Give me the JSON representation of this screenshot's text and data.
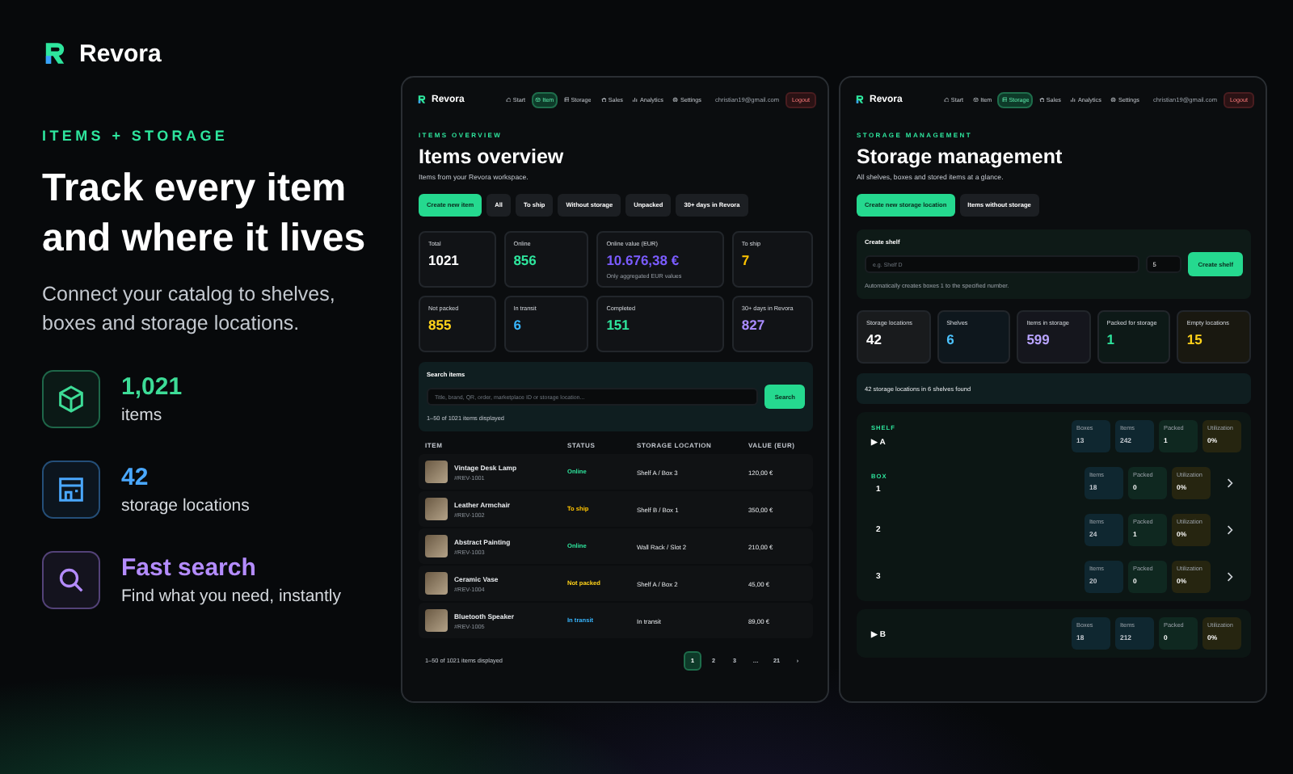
{
  "brand": {
    "name": "Revora"
  },
  "hero": {
    "eyebrow": "ITEMS + STORAGE",
    "headline": "Track every item and where it lives",
    "subtitle": "Connect your catalog to shelves, boxes and storage locations.",
    "features": [
      {
        "kind": "box",
        "color": "#3ddc97",
        "value": "1,021",
        "label": "items"
      },
      {
        "kind": "storage",
        "color": "#4aa8ff",
        "value": "42",
        "label": "storage locations"
      },
      {
        "kind": "search",
        "color": "#b48cff",
        "value": "Fast search",
        "label": "Find what you need, instantly"
      }
    ]
  },
  "items_app": {
    "nav": {
      "brand": "Revora",
      "tabs": [
        {
          "kind": "home",
          "label": "Start",
          "selected": false
        },
        {
          "kind": "item",
          "label": "Item",
          "selected": true
        },
        {
          "kind": "storage",
          "label": "Storage",
          "selected": false
        },
        {
          "kind": "sales",
          "label": "Sales",
          "selected": false
        },
        {
          "kind": "analytics",
          "label": "Analytics",
          "selected": false
        },
        {
          "kind": "settings",
          "label": "Settings",
          "selected": false
        }
      ],
      "account": "christian19@gmail.com",
      "logout": "Logout"
    },
    "eyebrow": "ITEMS OVERVIEW",
    "title": "Items overview",
    "subtitle": "Items from your Revora workspace.",
    "primary_action": "Create new item",
    "filters": [
      "All",
      "To ship",
      "Without storage",
      "Unpacked",
      "30+ days in Revora"
    ],
    "stats": [
      {
        "label": "Total",
        "value": "1021",
        "color": "#ffffff"
      },
      {
        "label": "Online",
        "value": "856",
        "color": "#2ee59d"
      },
      {
        "label": "Online value (EUR)",
        "value": "10.676,38 €",
        "color": "#7b5cff",
        "note": "Only aggregated EUR values"
      },
      {
        "label": "To ship",
        "value": "7",
        "color": "#ffc400"
      },
      {
        "label": "Not packed",
        "value": "855",
        "color": "#ffd21a"
      },
      {
        "label": "In transit",
        "value": "6",
        "color": "#38b6ff"
      },
      {
        "label": "Completed",
        "value": "151",
        "color": "#2ee59d"
      },
      {
        "label": "30+ days in Revora",
        "value": "827",
        "color": "#a98bff"
      }
    ],
    "search": {
      "title": "Search items",
      "placeholder": "Title, brand, QR, order, marketplace ID or storage location...",
      "button": "Search",
      "count": "1–50 of 1021 items displayed"
    },
    "table": {
      "columns": [
        "ITEM",
        "STATUS",
        "STORAGE LOCATION",
        "VALUE (EUR)"
      ],
      "rows": [
        {
          "name": "Vintage Desk Lamp",
          "sku": "#REV-1001",
          "status": "Online",
          "color": "#2ee59d",
          "location": "Shelf A / Box 3",
          "value": "120,00 €"
        },
        {
          "name": "Leather Armchair",
          "sku": "#REV-1002",
          "status": "To ship",
          "color": "#ffc400",
          "location": "Shelf B / Box 1",
          "value": "350,00 €"
        },
        {
          "name": "Abstract Painting",
          "sku": "#REV-1003",
          "status": "Online",
          "color": "#2ee59d",
          "location": "Wall Rack / Slot 2",
          "value": "210,00 €"
        },
        {
          "name": "Ceramic Vase",
          "sku": "#REV-1004",
          "status": "Not packed",
          "color": "#ffd21a",
          "location": "Shelf A / Box 2",
          "value": "45,00 €"
        },
        {
          "name": "Bluetooth Speaker",
          "sku": "#REV-1005",
          "status": "In transit",
          "color": "#38b6ff",
          "location": "In transit",
          "value": "89,00 €"
        }
      ]
    },
    "pagination": {
      "count": "1–50 of 1021 items displayed",
      "pages": [
        {
          "label": "1",
          "selected": true
        },
        {
          "label": "2",
          "selected": false
        },
        {
          "label": "3",
          "selected": false
        },
        {
          "label": "…",
          "selected": false
        },
        {
          "label": "21",
          "selected": false
        }
      ],
      "next": "›"
    }
  },
  "storage_app": {
    "nav": {
      "brand": "Revora",
      "tabs": [
        {
          "kind": "home",
          "label": "Start",
          "selected": false
        },
        {
          "kind": "item",
          "label": "Item",
          "selected": false
        },
        {
          "kind": "storage",
          "label": "Storage",
          "selected": true
        },
        {
          "kind": "sales",
          "label": "Sales",
          "selected": false
        },
        {
          "kind": "analytics",
          "label": "Analytics",
          "selected": false
        },
        {
          "kind": "settings",
          "label": "Settings",
          "selected": false
        }
      ],
      "account": "christian19@gmail.com",
      "logout": "Logout"
    },
    "eyebrow": "STORAGE MANAGEMENT",
    "title": "Storage management",
    "subtitle": "All shelves, boxes and stored items at a glance.",
    "actions": [
      {
        "kind": "primary",
        "label": "Create new storage location"
      },
      {
        "kind": "secondary",
        "label": "Items without storage"
      }
    ],
    "create_shelf": {
      "title": "Create shelf",
      "placeholder": "e.g. Shelf D",
      "box_count": "5",
      "button": "Create shelf",
      "hint": "Automatically creates boxes 1 to the specified number."
    },
    "stats": [
      {
        "label": "Storage locations",
        "value": "42",
        "color": "#ffffff"
      },
      {
        "label": "Shelves",
        "value": "6",
        "color": "#4cc3ff"
      },
      {
        "label": "Items in storage",
        "value": "599",
        "color": "#b9a4ff"
      },
      {
        "label": "Packed for storage",
        "value": "1",
        "color": "#2ee59d"
      },
      {
        "label": "Empty locations",
        "value": "15",
        "color": "#ffd21a"
      }
    ],
    "summary": "42 storage locations in 6 shelves found",
    "shelves": [
      {
        "eyebrow": "SHELF",
        "toggle": "▶",
        "name": "A",
        "metrics": [
          {
            "kind": "count",
            "label": "Boxes",
            "value": "13"
          },
          {
            "kind": "count",
            "label": "Items",
            "value": "242"
          },
          {
            "kind": "packed",
            "label": "Packed",
            "value": "1"
          },
          {
            "kind": "utilization",
            "label": "Utilization",
            "value": "0%"
          }
        ],
        "boxes": [
          {
            "eyebrow": "BOX",
            "name": "1",
            "metrics": [
              {
                "kind": "count",
                "label": "Items",
                "value": "18"
              },
              {
                "kind": "packed",
                "label": "Packed",
                "value": "0"
              },
              {
                "kind": "utilization",
                "label": "Utilization",
                "value": "0%"
              }
            ]
          },
          {
            "name": "2",
            "metrics": [
              {
                "kind": "count",
                "label": "Items",
                "value": "24"
              },
              {
                "kind": "packed",
                "label": "Packed",
                "value": "1"
              },
              {
                "kind": "utilization",
                "label": "Utilization",
                "value": "0%"
              }
            ]
          },
          {
            "name": "3",
            "metrics": [
              {
                "kind": "count",
                "label": "Items",
                "value": "20"
              },
              {
                "kind": "packed",
                "label": "Packed",
                "value": "0"
              },
              {
                "kind": "utilization",
                "label": "Utilization",
                "value": "0%"
              }
            ]
          }
        ]
      },
      {
        "toggle": "▶",
        "name": "B",
        "metrics": [
          {
            "kind": "count",
            "label": "Boxes",
            "value": "18"
          },
          {
            "kind": "count",
            "label": "Items",
            "value": "212"
          },
          {
            "kind": "packed",
            "label": "Packed",
            "value": "0"
          },
          {
            "kind": "utilization",
            "label": "Utilization",
            "value": "0%"
          }
        ]
      }
    ]
  }
}
